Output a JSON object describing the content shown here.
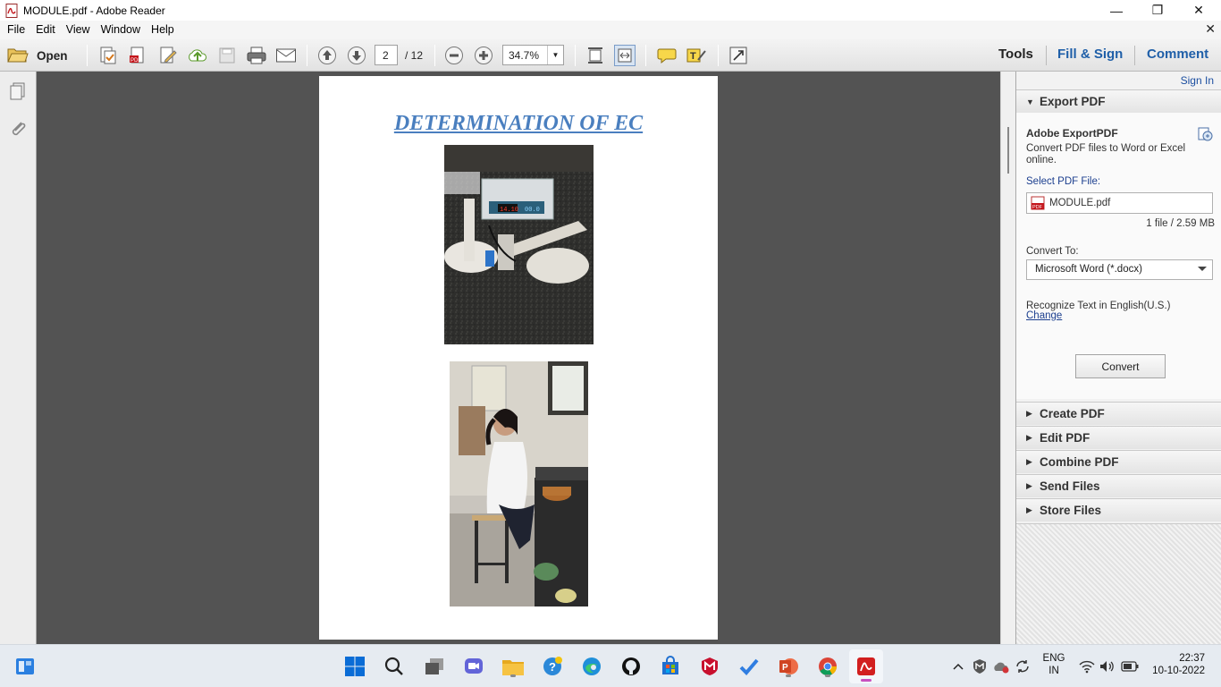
{
  "window": {
    "title": "MODULE.pdf - Adobe Reader",
    "minimize": "—",
    "restore": "❐",
    "close": "✕"
  },
  "menu": {
    "items": [
      "File",
      "Edit",
      "View",
      "Window",
      "Help"
    ],
    "close_doc": "✕"
  },
  "toolbar": {
    "open_label": "Open",
    "page_current": "2",
    "page_total": "/ 12",
    "zoom": "34.7%",
    "tools": "Tools",
    "fill_sign": "Fill & Sign",
    "comment": "Comment"
  },
  "document": {
    "heading": "DETERMINATION OF EC",
    "meter_display_left": "14.10",
    "meter_display_right": "00.0"
  },
  "right_pane": {
    "sign_in": "Sign In",
    "export_pdf": {
      "header": "Export PDF",
      "service_title": "Adobe ExportPDF",
      "description": "Convert PDF files to Word or Excel online.",
      "select_label": "Select PDF File:",
      "file_name": "MODULE.pdf",
      "file_icon_text": "PDF",
      "file_info": "1 file / 2.59 MB",
      "convert_to_label": "Convert To:",
      "convert_to_value": "Microsoft Word (*.docx)",
      "recognize": "Recognize Text in English(U.S.)",
      "change": "Change",
      "convert_button": "Convert"
    },
    "sections": [
      "Create PDF",
      "Edit PDF",
      "Combine PDF",
      "Send Files",
      "Store Files"
    ]
  },
  "taskbar": {
    "lang_line1": "ENG",
    "lang_line2": "IN",
    "time": "22:37",
    "date": "10-10-2022",
    "colors": {
      "start": "#0a6cd6",
      "explorer": "#f6c343",
      "edge": "#1f8fd9",
      "mcafee": "#c8102e",
      "powerpoint": "#d04423",
      "acrobat": "#d21f1f"
    }
  }
}
